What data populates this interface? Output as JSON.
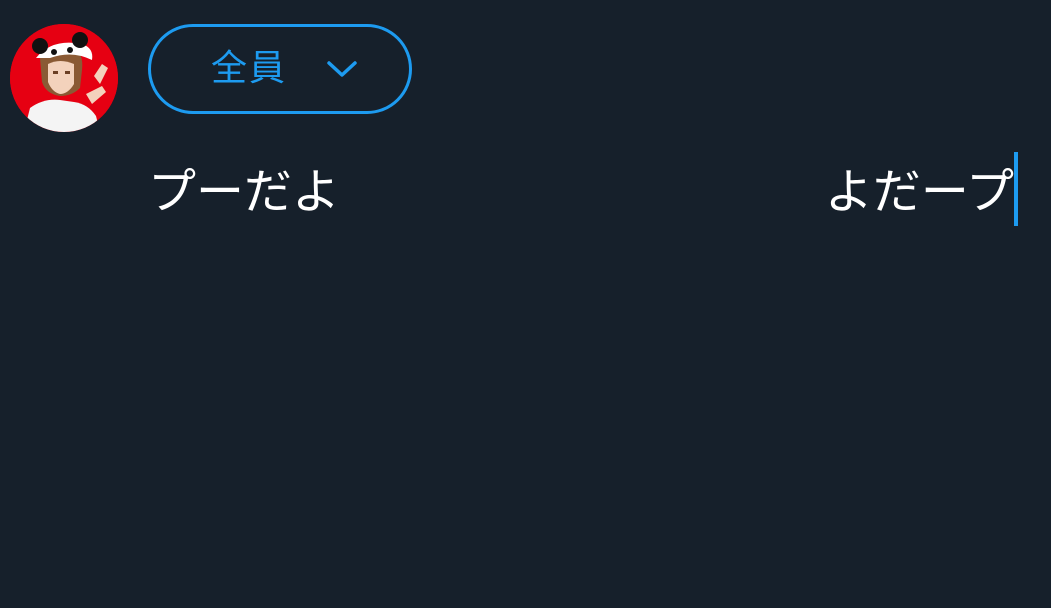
{
  "header": {
    "avatar_icon": "user-avatar-panda-hat",
    "audience_label": "全員",
    "audience_chevron_icon": "chevron-down-icon",
    "accent_color": "#1d9bf0",
    "background_color": "#16202b"
  },
  "compose": {
    "text_left": "プーだよ",
    "text_right": "よだープ"
  }
}
